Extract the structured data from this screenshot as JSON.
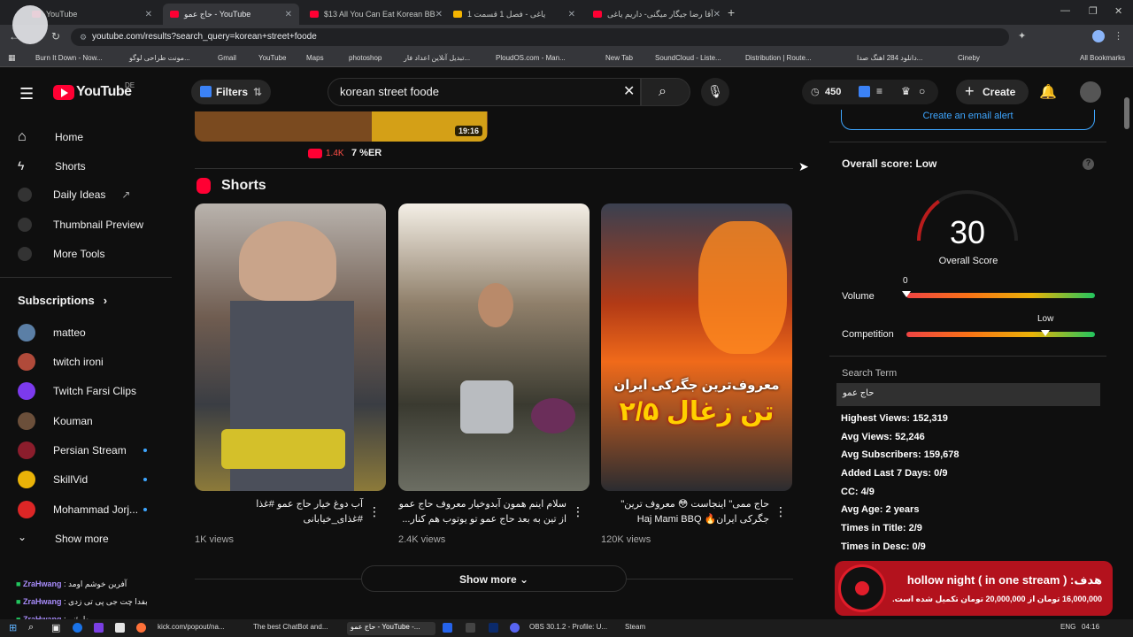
{
  "browser": {
    "tabs": [
      {
        "label": "YouTube"
      },
      {
        "label": "حاج عمو - YouTube"
      },
      {
        "label": "$13 All You Can Eat Korean BB"
      },
      {
        "label": "یاغی - فصل 1 قسمت 1"
      },
      {
        "label": "آقا رضا جیگار میگنی- داریم یاغی"
      }
    ],
    "url": "youtube.com/results?search_query=korean+street+foode",
    "bookmarks": [
      "Burn It Down - Now...",
      "مونت طراحی لوگو...",
      "Gmail",
      "YouTube",
      "Maps",
      "photoshop",
      "تبدیل آنلاین اعداد فار...",
      "PloudOS.com - Man...",
      "New Tab",
      "SoundCloud - Liste...",
      "Distribution | Route...",
      "دانلود 284 اهنگ صدا...",
      "Cineby",
      "All Bookmarks"
    ]
  },
  "header": {
    "logo": "YouTube",
    "region": "DE",
    "filters_label": "Filters",
    "search_value": "korean street foode",
    "count": "450",
    "create_label": "Create"
  },
  "sidebar": {
    "items": [
      {
        "label": "Home"
      },
      {
        "label": "Shorts"
      },
      {
        "label": "Daily Ideas"
      },
      {
        "label": "Thumbnail Preview"
      },
      {
        "label": "More Tools"
      }
    ],
    "subscriptions_label": "Subscriptions",
    "subs": [
      {
        "label": "matteo"
      },
      {
        "label": "twitch ironi"
      },
      {
        "label": "Twitch Farsi Clips"
      },
      {
        "label": "Kouman"
      },
      {
        "label": "Persian Stream"
      },
      {
        "label": "SkillVid"
      },
      {
        "label": "Mohammad Jorj..."
      }
    ],
    "show_more": "Show more"
  },
  "top_video": {
    "duration": "19:16",
    "likes": "1.4K",
    "er": "7 %ER"
  },
  "shorts": {
    "heading": "Shorts",
    "items": [
      {
        "title": "آب دوغ خیار حاج عمو #غذا #غذای_خیابانی",
        "views": "1K views"
      },
      {
        "title": "سلام اینم همون آبدوخیار معروف حاج عمو از تین به بعد حاج عمو تو یوتوب هم کنار...",
        "views": "2.4K views"
      },
      {
        "title": "حاج ممی\" اینجاست 😳 معروف ترین\" جگرکی ایران🔥 Haj Mami BBQ",
        "views": "120K views"
      }
    ],
    "overlay_line1": "معروف‌ترین جگرکی ایران",
    "overlay_line2": "۲/۵ تن زغال",
    "show_more": "Show more"
  },
  "panel": {
    "email_alert": "Create an email alert",
    "overall_label": "Overall score: Low",
    "score": "30",
    "score_caption": "Overall Score",
    "volume_label": "Volume",
    "volume_value": "0",
    "competition_label": "Competition",
    "competition_value": "Low",
    "search_term_label": "Search Term",
    "search_term_value": "حاج عمو",
    "stats": [
      "Highest Views: 152,319",
      "Avg Views: 52,246",
      "Avg Subscribers: 159,678",
      "Added Last 7 Days: 0/9",
      "CC: 4/9",
      "Avg Age: 2 years",
      "Times in Title: 2/9",
      "Times in Desc: 0/9"
    ]
  },
  "chat": [
    {
      "user": "ZraHwang",
      "msg": "آفرین خوشم اومد"
    },
    {
      "user": "ZraHwang",
      "msg": "بفدا چت جی پی تی زدی"
    },
    {
      "user": "ZraHwang",
      "msg": "مطمئنم"
    }
  ],
  "donation": {
    "goal_label": "هدف:",
    "goal_title": "( hollow night ( in one stream",
    "progress_text": "16,000,000 تومان از 20,000,000 تومان تکمیل شده است."
  },
  "taskbar": {
    "items": [
      "kick.com/popout/na...",
      "The best ChatBot and...",
      "حاج عمو - YouTube -...",
      "OBS 30.1.2 - Profile: U...",
      "Steam"
    ],
    "lang": "ENG",
    "time": "04:16"
  },
  "colors": {
    "youtube_red": "#ff0033",
    "accent_blue": "#3ea6ff",
    "slider_green": "#22c55e",
    "slider_red": "#ef4444"
  }
}
